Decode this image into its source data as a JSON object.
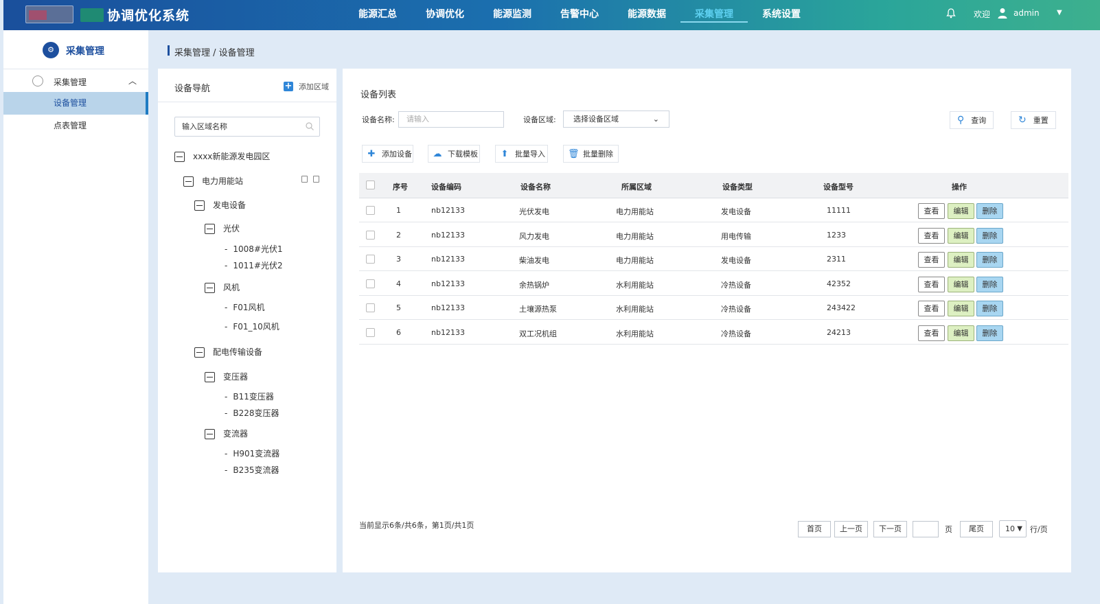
{
  "app_title": "协调优化系统",
  "nav": [
    "能源汇总",
    "协调优化",
    "能源监测",
    "告警中心",
    "能源数据",
    "采集管理",
    "系统设置"
  ],
  "nav_active_index": 5,
  "user": {
    "welcome": "欢迎",
    "name": "admin"
  },
  "sidebar": {
    "title": "采集管理",
    "group": "采集管理",
    "items": [
      "设备管理",
      "点表管理"
    ],
    "active_index": 0
  },
  "breadcrumb": "采集管理 / 设备管理",
  "tree_panel": {
    "title": "设备导航",
    "add_label": "添加区域",
    "search_placeholder": "输入区域名称",
    "nodes": {
      "root": "xxxx新能源发电园区",
      "station": "电力用能站",
      "gen": "发电设备",
      "pv": "光伏",
      "pv1": "1008#光伏1",
      "pv2": "1011#光伏2",
      "wind": "风机",
      "wind1": "F01风机",
      "wind2": "F01_10风机",
      "dist": "配电传输设备",
      "trans": "变压器",
      "trans1": "B11变压器",
      "trans2": "B228变压器",
      "conv": "变流器",
      "conv1": "H901变流器",
      "conv2": "B235变流器"
    }
  },
  "main": {
    "title": "设备列表",
    "filters": {
      "name_label": "设备名称:",
      "name_placeholder": "请输入",
      "area_label": "设备区域:",
      "area_value": "选择设备区域"
    },
    "buttons": {
      "search": "查询",
      "reset": "重置",
      "add": "添加设备",
      "download": "下载模板",
      "import": "批量导入",
      "delete": "批量删除"
    },
    "columns": [
      "序号",
      "设备编码",
      "设备名称",
      "所属区域",
      "设备类型",
      "设备型号",
      "操作"
    ],
    "rows": [
      [
        "1",
        "nb12133",
        "光伏发电",
        "电力用能站",
        "发电设备",
        "11111"
      ],
      [
        "2",
        "nb12133",
        "风力发电",
        "电力用能站",
        "用电传输",
        "1233"
      ],
      [
        "3",
        "nb12133",
        "柴油发电",
        "电力用能站",
        "发电设备",
        "2311"
      ],
      [
        "4",
        "nb12133",
        "余热锅炉",
        "水利用能站",
        "冷热设备",
        "42352"
      ],
      [
        "5",
        "nb12133",
        "土壤源热泵",
        "水利用能站",
        "冷热设备",
        "243422"
      ],
      [
        "6",
        "nb12133",
        "双工况机组",
        "水利用能站",
        "冷热设备",
        "24213"
      ]
    ],
    "actions": {
      "view": "查看",
      "edit": "编辑",
      "delete": "删除"
    },
    "pagination": {
      "info": "当前显示6条/共6条，第1页/共1页",
      "first": "首页",
      "prev": "上一页",
      "next": "下一页",
      "page_suffix": "页",
      "last": "尾页",
      "page_size": "10",
      "page_size_suffix": "行/页"
    }
  },
  "colors": {
    "nav_active": "#5ed0f0",
    "primary": "#1d4f9e",
    "edit_bg": "#ddf0c2",
    "delete_bg": "#a8d6f1"
  }
}
